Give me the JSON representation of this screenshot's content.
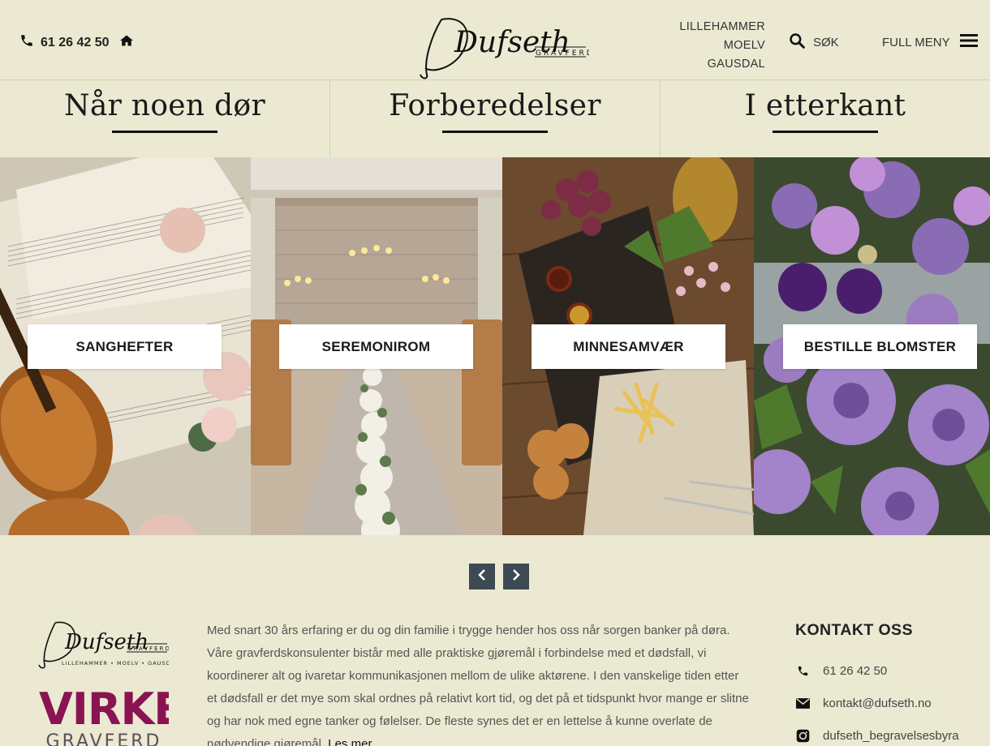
{
  "header": {
    "phone": "61 26 42 50",
    "logo_text": "Dufseth",
    "logo_sub": "GRAVFERD",
    "locations": [
      "LILLEHAMMER",
      "MOELV",
      "GAUSDAL"
    ],
    "search_label": "SØK",
    "menu_label": "FULL MENY"
  },
  "sections": [
    {
      "label": "Når noen dør"
    },
    {
      "label": "Forberedelser"
    },
    {
      "label": "I etterkant"
    }
  ],
  "tiles": [
    {
      "label": "SANGHEFTER"
    },
    {
      "label": "SEREMONIROM"
    },
    {
      "label": "MINNESAMVÆR"
    },
    {
      "label": "BESTILLE BLOMSTER"
    }
  ],
  "footer": {
    "logo_text": "Dufseth",
    "logo_sub": "GRAVFERD",
    "logo_places": "LILLEHAMMER • MOELV • GAUSDAL",
    "virke_line1": "VIRKE",
    "virke_line2": "GRAVFERD",
    "about_text": "Med snart 30 års erfaring er du og din familie i trygge hender hos oss når sorgen banker på døra. Våre gravferdskonsulenter bistår med alle praktiske gjøremål i forbindelse med et dødsfall, vi koordinerer alt og ivaretar kommunikasjonen mellom de ulike aktørene. I den vanskelige tiden etter et dødsfall er det mye som skal ordnes på relativt kort tid, og det på et tidspunkt hvor mange er slitne og har nok med egne tanker og følelser. De fleste synes det er en lettelse å kunne overlate de nødvendige gjøremål.",
    "read_more": "Les mer",
    "contact_title": "KONTAKT OSS",
    "contact_phone": "61 26 42 50",
    "contact_email": "kontakt@dufseth.no",
    "contact_instagram": "dufseth_begravelsesbyra"
  },
  "colors": {
    "background": "#ebe9d1",
    "arrow_bg": "#3d4a55",
    "virke": "#8a1452"
  }
}
